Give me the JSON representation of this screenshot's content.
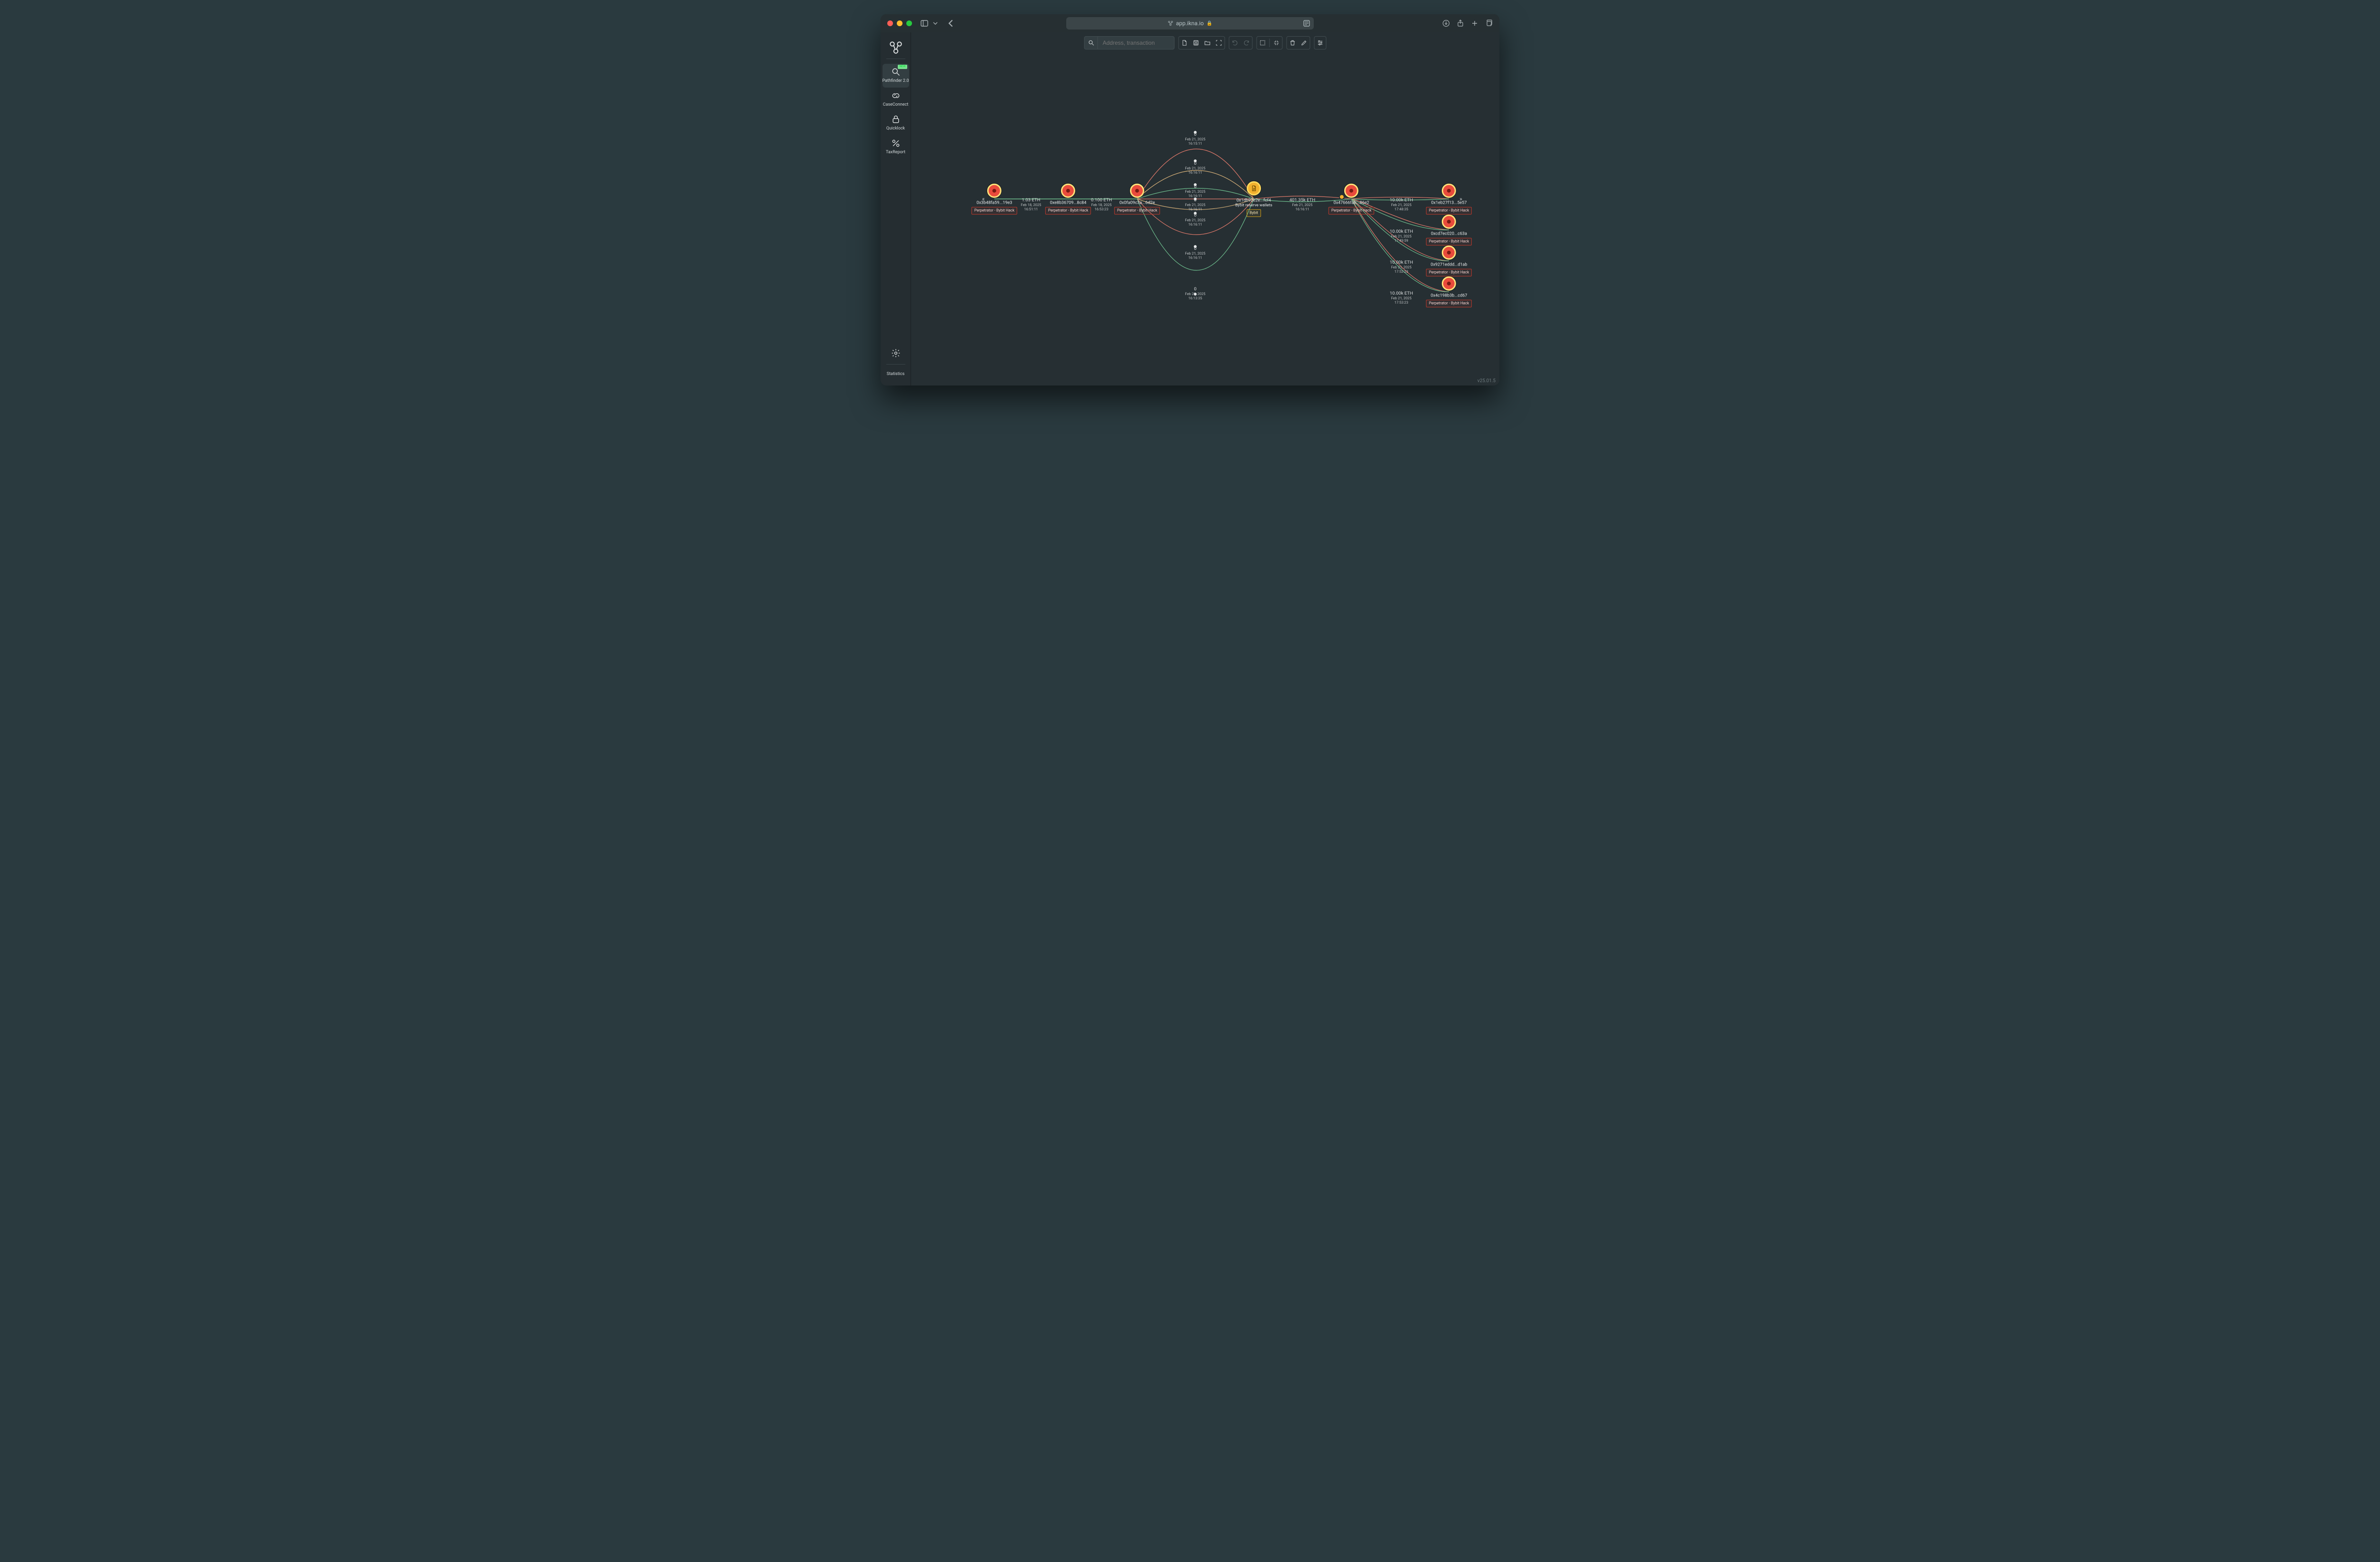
{
  "browser": {
    "url": "app.ikna.io"
  },
  "sidebar": {
    "items": [
      {
        "label": "Pathfinder 2.0",
        "badge": "NEW"
      },
      {
        "label": "CaseConnect"
      },
      {
        "label": "Quicklock"
      },
      {
        "label": "TaxReport"
      }
    ],
    "statistics_label": "Statistics"
  },
  "search": {
    "placeholder": "Address, transaction"
  },
  "version": "v25.01.5",
  "nodes": {
    "n1": {
      "address": "0x3b48fa59...19e3",
      "tag": "Perpetrator - Bybit Hack"
    },
    "n2": {
      "address": "0xe8b36709...8c84",
      "tag": "Perpetrator - Bybit Hack"
    },
    "n3": {
      "address": "0x0fa09c3a...6d2e",
      "tag": "Perpetrator - Bybit Hack"
    },
    "n4": {
      "address": "0x1db92e2e...fcf4",
      "sub": "Bybit reserve wallets",
      "tag": "Bybit"
    },
    "n5": {
      "address": "0x47666fab...86e2",
      "tag": "Perpetrator - Bybit Hack"
    },
    "n6": {
      "address": "0x1eb27f13...5e57",
      "tag": "Perpetrator - Bybit Hack"
    },
    "n7": {
      "address": "0xcd7ec020...c63a",
      "tag": "Perpetrator - Bybit Hack"
    },
    "n8": {
      "address": "0x9271eddd...d1ab",
      "tag": "Perpetrator - Bybit Hack"
    },
    "n9": {
      "address": "0x4c198b3b...cd67",
      "tag": "Perpetrator - Bybit Hack"
    }
  },
  "edges": {
    "e12": {
      "amount": "1.03 ETH",
      "date": "Feb 18, 2025",
      "time": "16:51:11"
    },
    "e23": {
      "amount": "0.100 ETH",
      "date": "Feb 18, 2025",
      "time": "16:53:23"
    },
    "curve1": {
      "amount": "0",
      "date": "Feb 21, 2025",
      "time": "16:15:11"
    },
    "curve2": {
      "amount": "0",
      "date": "Feb 21, 2025",
      "time": "16:16:11"
    },
    "curve3": {
      "amount": "0",
      "date": "Feb 21, 2025",
      "time": "16:16:11"
    },
    "curve4": {
      "amount": "0",
      "date": "Feb 21, 2025",
      "time": "16:16:11"
    },
    "curve5": {
      "amount": "0",
      "date": "Feb 21, 2025",
      "time": "16:16:11"
    },
    "curve6": {
      "amount": "0",
      "date": "Feb 21, 2025",
      "time": "16:16:11"
    },
    "curve7": {
      "amount": "0",
      "date": "Feb 21, 2025",
      "time": "16:13:35"
    },
    "e45": {
      "amount": "401.35k ETH",
      "date": "Feb 21, 2025",
      "time": "16:16:11"
    },
    "e56": {
      "amount": "10.00k ETH",
      "date": "Feb 21, 2025",
      "time": "17:48:35"
    },
    "e57": {
      "amount": "10.00k ETH",
      "date": "Feb 21, 2025",
      "time": "17:49:59"
    },
    "e58": {
      "amount": "10.00k ETH",
      "date": "Feb 21, 2025",
      "time": "17:52:23"
    },
    "e59": {
      "amount": "10.00k ETH",
      "date": "Feb 21, 2025",
      "time": "17:53:23"
    }
  }
}
